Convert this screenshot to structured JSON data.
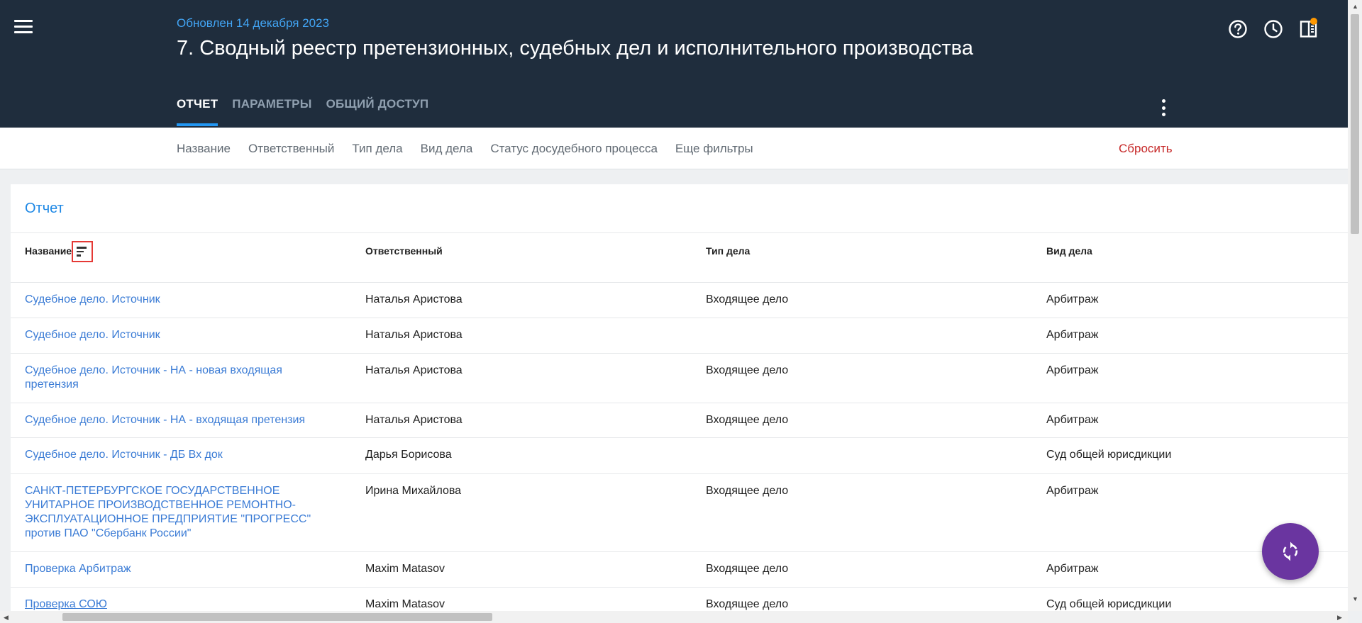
{
  "header": {
    "updated": "Обновлен 14 декабря 2023",
    "title": "7. Сводный реестр претензионных, судебных дел и исполнительного производства",
    "tabs": [
      {
        "label": "ОТЧЕТ",
        "active": true
      },
      {
        "label": "ПАРАМЕТРЫ",
        "active": false
      },
      {
        "label": "ОБЩИЙ ДОСТУП",
        "active": false
      }
    ],
    "icons": [
      "menu-icon",
      "help-icon",
      "history-icon",
      "panel-icon",
      "more-vert-icon"
    ]
  },
  "filters": {
    "items": [
      "Название",
      "Ответственный",
      "Тип дела",
      "Вид дела",
      "Статус досудебного процесса",
      "Еще фильтры"
    ],
    "reset": "Сбросить"
  },
  "report": {
    "title": "Отчет",
    "columns": [
      "Название",
      "Ответственный",
      "Тип дела",
      "Вид дела"
    ],
    "rows": [
      [
        "Судебное дело. Источник",
        "Наталья Аристова",
        "Входящее дело",
        "Арбитраж"
      ],
      [
        "Судебное дело. Источник",
        "Наталья Аристова",
        "",
        "Арбитраж"
      ],
      [
        "Судебное дело. Источник - НА - новая входящая претензия",
        "Наталья Аристова",
        "Входящее дело",
        "Арбитраж"
      ],
      [
        "Судебное дело. Источник - НА - входящая претензия",
        "Наталья Аристова",
        "Входящее дело",
        "Арбитраж"
      ],
      [
        "Судебное дело. Источник - ДБ Вх док",
        "Дарья Борисова",
        "",
        "Суд общей юрисдикции"
      ],
      [
        "САНКТ-ПЕТЕРБУРГСКОЕ ГОСУДАРСТВЕННОЕ УНИТАРНОЕ ПРОИЗВОДСТВЕННОЕ РЕМОНТНО-ЭКСПЛУАТАЦИОННОЕ ПРЕДПРИЯТИЕ \"ПРОГРЕСС\" против ПАО \"Сбербанк России\"",
        "Ирина Михайлова",
        "Входящее дело",
        "Арбитраж"
      ],
      [
        "Проверка Арбитраж",
        "Maxim Matasov",
        "Входящее дело",
        "Арбитраж"
      ],
      [
        "Проверка СОЮ",
        "Maxim Matasov",
        "Входящее дело",
        "Суд общей юрисдикции"
      ]
    ]
  },
  "fab_icon": "refresh-icon",
  "colors": {
    "header_bg": "#1f2d3d",
    "accent": "#2196f3",
    "link": "#3a7bd5",
    "reset": "#c62828",
    "fab": "#6a35a0"
  }
}
